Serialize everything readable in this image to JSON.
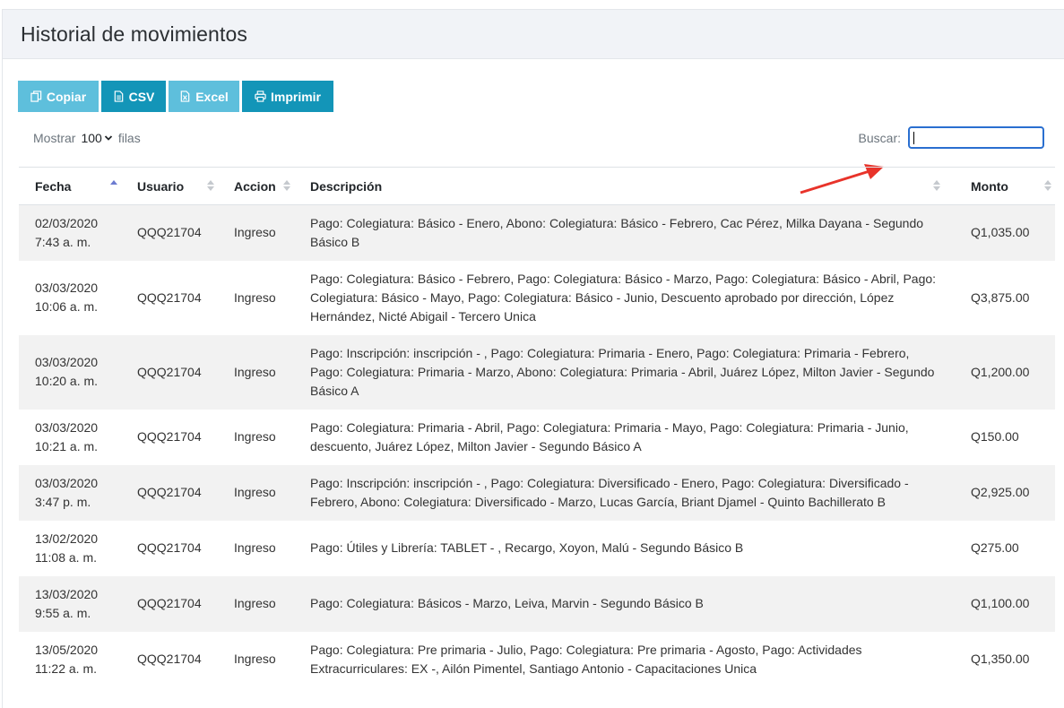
{
  "header": {
    "title": "Historial de movimientos"
  },
  "toolbar": {
    "copy": "Copiar",
    "csv": "CSV",
    "excel": "Excel",
    "print": "Imprimir"
  },
  "length": {
    "prefix": "Mostrar",
    "value": "100",
    "suffix": "filas"
  },
  "search": {
    "label": "Buscar:",
    "value": ""
  },
  "table": {
    "columns": [
      "Fecha",
      "Usuario",
      "Accion",
      "Descripción",
      "Monto"
    ],
    "sorted_column": "Fecha",
    "sort_direction": "asc",
    "rows": [
      {
        "date": "02/03/2020",
        "time": "7:43 a. m.",
        "user": "QQQ21704",
        "action": "Ingreso",
        "desc": "Pago: Colegiatura: Básico - Enero, Abono: Colegiatura: Básico - Febrero, Cac Pérez, Milka Dayana - Segundo Básico B",
        "amount": "Q1,035.00",
        "lines": 2
      },
      {
        "date": "03/03/2020",
        "time": "10:06 a. m.",
        "user": "QQQ21704",
        "action": "Ingreso",
        "desc": "Pago: Colegiatura: Básico - Febrero, Pago: Colegiatura: Básico - Marzo, Pago: Colegiatura: Básico - Abril, Pago: Colegiatura: Básico - Mayo, Pago: Colegiatura: Básico - Junio, Descuento aprobado por dirección, López Hernández, Nicté Abigail - Tercero Unica",
        "amount": "Q3,875.00",
        "lines": 3
      },
      {
        "date": "03/03/2020",
        "time": "10:20 a. m.",
        "user": "QQQ21704",
        "action": "Ingreso",
        "desc": "Pago: Inscripción: inscripción - , Pago: Colegiatura: Primaria - Enero, Pago: Colegiatura: Primaria - Febrero, Pago: Colegiatura: Primaria - Marzo, Abono: Colegiatura: Primaria - Abril, Juárez López, Milton Javier - Segundo Básico A",
        "amount": "Q1,200.00",
        "lines": 3
      },
      {
        "date": "03/03/2020",
        "time": "10:21 a. m.",
        "user": "QQQ21704",
        "action": "Ingreso",
        "desc": "Pago: Colegiatura: Primaria - Abril, Pago: Colegiatura: Primaria - Mayo, Pago: Colegiatura: Primaria - Junio, descuento, Juárez López, Milton Javier - Segundo Básico A",
        "amount": "Q150.00",
        "lines": 2
      },
      {
        "date": "03/03/2020",
        "time": "3:47 p. m.",
        "user": "QQQ21704",
        "action": "Ingreso",
        "desc": "Pago: Inscripción: inscripción - , Pago: Colegiatura: Diversificado - Enero, Pago: Colegiatura: Diversificado - Febrero, Abono: Colegiatura: Diversificado - Marzo, Lucas García, Briant Djamel - Quinto Bachillerato B",
        "amount": "Q2,925.00",
        "lines": 2
      },
      {
        "date": "13/02/2020",
        "time": "11:08 a. m.",
        "user": "QQQ21704",
        "action": "Ingreso",
        "desc": "Pago: Útiles y Librería: TABLET - , Recargo, Xoyon, Malú - Segundo Básico B",
        "amount": "Q275.00",
        "lines": 2
      },
      {
        "date": "13/03/2020",
        "time": "9:55 a. m.",
        "user": "QQQ21704",
        "action": "Ingreso",
        "desc": "Pago: Colegiatura: Básicos - Marzo, Leiva, Marvin - Segundo Básico B",
        "amount": "Q1,100.00",
        "lines": 2
      },
      {
        "date": "13/05/2020",
        "time": "11:22 a. m.",
        "user": "QQQ21704",
        "action": "Ingreso",
        "desc": "Pago: Colegiatura: Pre primaria - Julio, Pago: Colegiatura: Pre primaria - Agosto, Pago: Actividades Extracurriculares: EX -, Ailón Pimentel, Santiago Antonio - Capacitaciones Unica",
        "amount": "Q1,350.00",
        "lines": 2
      }
    ]
  },
  "colors": {
    "button_light": "#5ebfdc",
    "button_dark": "#1395b8",
    "focus_border": "#2a6fd0",
    "annotation_arrow": "#e8332a"
  }
}
